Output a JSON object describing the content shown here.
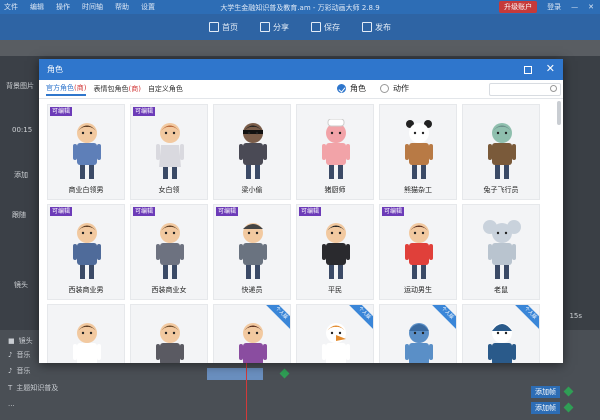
{
  "app": {
    "menu": [
      "文件",
      "编辑",
      "操作",
      "时间轴",
      "帮助",
      "设置"
    ],
    "title": "大学生金融知识普及教育.am - 万彩动画大师 2.8.9",
    "promo": "升级账户",
    "login": "登录",
    "toolbar": [
      {
        "icon": "home-icon",
        "label": "首页"
      },
      {
        "icon": "share-icon",
        "label": "分享"
      },
      {
        "icon": "save-icon",
        "label": "保存"
      },
      {
        "icon": "publish-icon",
        "label": "发布"
      }
    ],
    "left_label_1": "背景图片",
    "left_label_2": "00:15",
    "left_label_3": "添加",
    "left_label_4": "跟随",
    "left_label_5": "镜头"
  },
  "timeline": {
    "rows": [
      "镜头",
      "音乐",
      "音乐",
      "主题知识普及",
      "..."
    ],
    "btn": "添加帧",
    "right_time": "15s"
  },
  "modal": {
    "title": "角色",
    "tabs": [
      {
        "label": "官方角色",
        "tag": "(商)"
      },
      {
        "label": "表情包角色",
        "tag": "(商)"
      },
      {
        "label": "自定义角色",
        "tag": ""
      }
    ],
    "mode_role": "角色",
    "mode_action": "动作",
    "search_placeholder": "",
    "badge_editable": "可编辑",
    "badge_vip": "个人版",
    "characters": [
      {
        "name": "商业白领男",
        "badge": "editable",
        "skin": "#f2c9a0",
        "hair": "#5a3b22",
        "body": "#5e7fb8",
        "extra": ""
      },
      {
        "name": "女白领",
        "badge": "editable",
        "skin": "#f2c9a0",
        "hair": "#b9683a",
        "body": "#d9d9df",
        "extra": "skirt"
      },
      {
        "name": "梁小偷",
        "badge": "",
        "skin": "#7a5d4a",
        "hair": "#222",
        "body": "#4a4a55",
        "extra": "mask"
      },
      {
        "name": "猪厨师",
        "badge": "",
        "skin": "#f2a3a8",
        "hair": "#ffffff",
        "body": "#f2a3a8",
        "extra": "chef"
      },
      {
        "name": "熊猫杂工",
        "badge": "",
        "skin": "#ffffff",
        "hair": "#222",
        "body": "#b87a45",
        "extra": "panda"
      },
      {
        "name": "兔子飞行员",
        "badge": "",
        "skin": "#8fbfae",
        "hair": "#6b8f8a",
        "body": "#7a5a3a",
        "extra": ""
      },
      {
        "name": "西装商业男",
        "badge": "editable",
        "skin": "#f2c9a0",
        "hair": "#5a3b22",
        "body": "#4f6b9a",
        "extra": ""
      },
      {
        "name": "西装商业女",
        "badge": "editable",
        "skin": "#f2c9a0",
        "hair": "#5a3b22",
        "body": "#6d7280",
        "extra": ""
      },
      {
        "name": "快递员",
        "badge": "editable",
        "skin": "#f2c9a0",
        "hair": "#444",
        "body": "#6a7380",
        "extra": "cap"
      },
      {
        "name": "平民",
        "badge": "editable",
        "skin": "#f2c9a0",
        "hair": "#222",
        "body": "#2a2a2e",
        "extra": ""
      },
      {
        "name": "运动男生",
        "badge": "editable",
        "skin": "#f2c9a0",
        "hair": "#5a2e1e",
        "body": "#e0403a",
        "extra": ""
      },
      {
        "name": "老鼠",
        "badge": "",
        "skin": "#c9d2dc",
        "hair": "#c9d2dc",
        "body": "#b9c4cf",
        "extra": "mouse"
      },
      {
        "name": "",
        "badge": "",
        "skin": "#f2c9a0",
        "hair": "#5a3b22",
        "body": "#ffffff",
        "extra": "nurse"
      },
      {
        "name": "",
        "badge": "",
        "skin": "#f2c9a0",
        "hair": "#6b4a2a",
        "body": "#5a5a62",
        "extra": ""
      },
      {
        "name": "",
        "badge": "vip",
        "skin": "#f2c9a0",
        "hair": "#5a2e1e",
        "body": "#8a4da0",
        "extra": ""
      },
      {
        "name": "",
        "badge": "vip",
        "skin": "#ffffff",
        "hair": "#e38b2e",
        "body": "#ffffff",
        "extra": "bird"
      },
      {
        "name": "",
        "badge": "vip",
        "skin": "#5a8fc7",
        "hair": "#3a6aa0",
        "body": "#5a8fc7",
        "extra": "fox"
      },
      {
        "name": "",
        "badge": "vip",
        "skin": "#ffffff",
        "hair": "#2a5a8a",
        "body": "#2a5a8a",
        "extra": "penguin"
      }
    ]
  },
  "colors": {
    "accent": "#2f76cc",
    "badge": "#6c3bb8",
    "tag": "#d23a3a"
  }
}
